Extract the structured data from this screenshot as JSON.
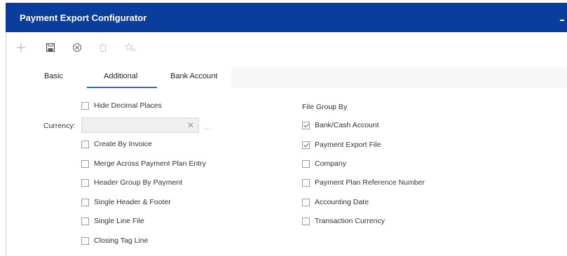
{
  "window": {
    "title": "Payment Export Configurator"
  },
  "toolbar": {
    "icons": [
      "add-icon",
      "save-icon",
      "cancel-icon",
      "delete-icon",
      "favorite-icon"
    ]
  },
  "tabs": [
    {
      "label": "Basic"
    },
    {
      "label": "Additional",
      "active": true
    },
    {
      "label": "Bank Account"
    }
  ],
  "left_options": {
    "hide_decimal_places": {
      "label": "Hide Decimal Places",
      "checked": false
    },
    "currency": {
      "label": "Currency:",
      "value": ""
    },
    "items": [
      {
        "label": "Create By Invoice",
        "checked": false
      },
      {
        "label": "Merge Across Payment Plan Entry",
        "checked": false
      },
      {
        "label": "Header Group By Payment",
        "checked": false
      },
      {
        "label": "Single Header & Footer",
        "checked": false
      },
      {
        "label": "Single Line File",
        "checked": false
      },
      {
        "label": "Closing Tag Line",
        "checked": false
      }
    ]
  },
  "file_group": {
    "title": "File Group By",
    "items": [
      {
        "label": "Bank/Cash Account",
        "checked": true
      },
      {
        "label": "Payment Export File",
        "checked": true
      },
      {
        "label": "Company",
        "checked": false
      },
      {
        "label": "Payment Plan Reference Number",
        "checked": false
      },
      {
        "label": "Accounting Date",
        "checked": false
      },
      {
        "label": "Transaction Currency",
        "checked": false
      }
    ]
  },
  "colors": {
    "titlebar": "#0a3d9c",
    "accent": "#1e6fd0"
  }
}
